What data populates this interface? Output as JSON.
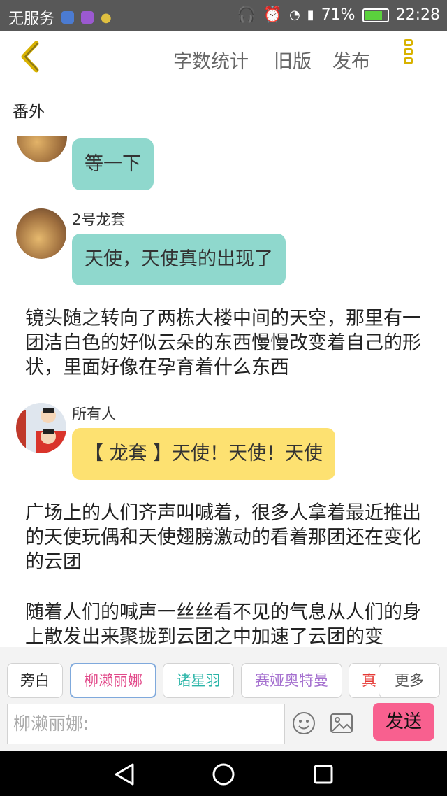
{
  "status_bar": {
    "carrier": "无服务",
    "battery": "71%",
    "battery_level": 0.71,
    "time": "22:28"
  },
  "header": {
    "word_count": "字数统计",
    "old_version": "旧版",
    "publish": "发布"
  },
  "chapter_title": "番外",
  "messages": [
    {
      "text": "等一下"
    },
    {
      "sender": "2号龙套",
      "text": "天使，天使真的出现了"
    },
    {
      "sender": "所有人",
      "text": "【 龙套 】天使！天使！天使"
    }
  ],
  "narration": [
    "镜头随之转向了两栋大楼中间的天空，那里有一团洁白色的好似云朵的东西慢慢改变着自己的形状，里面好像在孕育着什么东西",
    "广场上的人们齐声叫喊着，很多人拿着最近推出的天使玩偶和天使翅膀激动的看着那团还在变化的云团",
    "随着人们的喊声一丝丝看不见的气息从人们的身上散发出来聚拢到云团之中加速了云团的变"
  ],
  "characters": [
    {
      "label": "旁白",
      "color": "#888888"
    },
    {
      "label": "柳濑丽娜",
      "color": "#e24a8a",
      "selected": true
    },
    {
      "label": "诸星羽",
      "color": "#2bb5a8"
    },
    {
      "label": "赛娅奥特曼",
      "color": "#a46fcf"
    },
    {
      "label": "真",
      "color": "#e53935"
    }
  ],
  "more_button": "更多",
  "input_placeholder": "柳濑丽娜:",
  "send_button": "发送",
  "colors": {
    "bubble_teal": "#8fd8cd",
    "bubble_yellow": "#fde171",
    "accent_yellow": "#d8b200",
    "send_pink": "#f8608f"
  }
}
